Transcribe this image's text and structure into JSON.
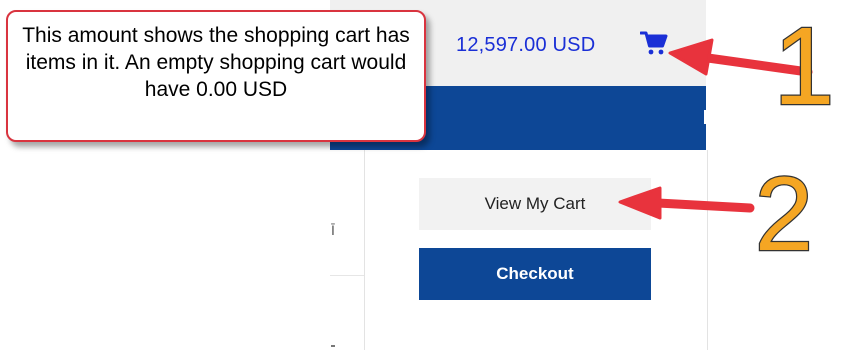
{
  "header": {
    "cart_total": "12,597.00 USD",
    "cart_icon": "shopping-cart-icon"
  },
  "cart_menu": {
    "view_cart_label": "View My Cart",
    "checkout_label": "Checkout"
  },
  "annotations": {
    "callout_text": "This amount shows the shopping cart has items in it. An empty shopping cart would have 0.00 USD",
    "marker_1": "1",
    "marker_2": "2"
  },
  "colors": {
    "brand_blue": "#0d4796",
    "total_text": "#1a2fd6",
    "arrow_red": "#e8333d",
    "marker_orange": "#f5a623"
  }
}
